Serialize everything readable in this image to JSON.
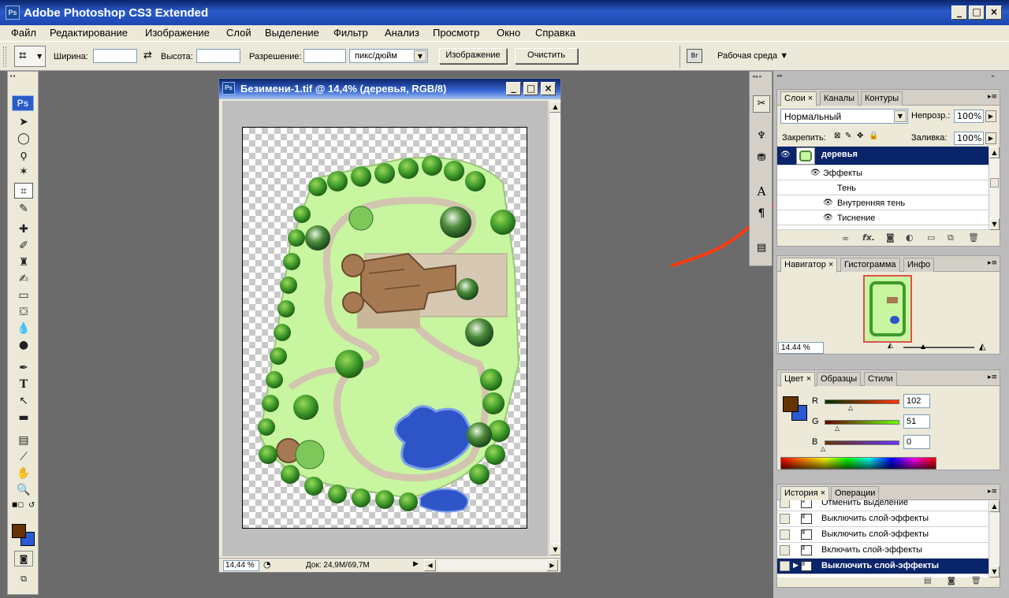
{
  "app": {
    "title": "Adobe Photoshop CS3 Extended",
    "icon": "Ps"
  },
  "menu": [
    "Файл",
    "Редактирование",
    "Изображение",
    "Слой",
    "Выделение",
    "Фильтр",
    "Анализ",
    "Просмотр",
    "Окно",
    "Справка"
  ],
  "options": {
    "width_label": "Ширина:",
    "width_value": "",
    "height_label": "Высота:",
    "height_value": "",
    "resolution_label": "Разрешение:",
    "resolution_value": "",
    "resolution_unit": "пикс/дюйм",
    "image_button": "Изображение",
    "clear_button": "Очистить",
    "workspace": "Рабочая среда ▼"
  },
  "toolbox": {
    "logo": "Ps"
  },
  "document": {
    "title": "Безимени-1.tif @ 14,4% (деревья, RGB/8)",
    "zoom": "14,44 %",
    "doc_size": "Док: 24,9M/69,7M"
  },
  "layers_panel": {
    "tabs": [
      "Слои ×",
      "Каналы",
      "Контуры"
    ],
    "blend_mode": "Нормальный",
    "opacity_label": "Непрозр.:",
    "opacity": "100%",
    "lock_label": "Закрепить:",
    "fill_label": "Заливка:",
    "fill": "100%",
    "layer_name": "деревья",
    "effects_label": "Эффекты",
    "effects": [
      "Тень",
      "Внутренняя тень",
      "Тиснение"
    ]
  },
  "navigator_panel": {
    "tabs": [
      "Навигатор ×",
      "Гистограмма",
      "Инфо"
    ],
    "zoom": "14.44 %"
  },
  "color_panel": {
    "tabs": [
      "Цвет ×",
      "Образцы",
      "Стили"
    ],
    "r_label": "R",
    "r": "102",
    "g_label": "G",
    "g": "51",
    "b_label": "B",
    "b": "0",
    "foreground": "#663300",
    "background": "#2b5bd4"
  },
  "history_panel": {
    "tabs": [
      "История ×",
      "Операции"
    ],
    "items": [
      "Отменить выделение",
      "Выключить слой-эффекты",
      "Выключить слой-эффекты",
      "Включить слой-эффекты",
      "Выключить слой-эффекты"
    ]
  },
  "colors": {
    "titlebar": "#0a246a",
    "selection": "#0a246a",
    "annotation_arrow": "#ff3a10"
  }
}
